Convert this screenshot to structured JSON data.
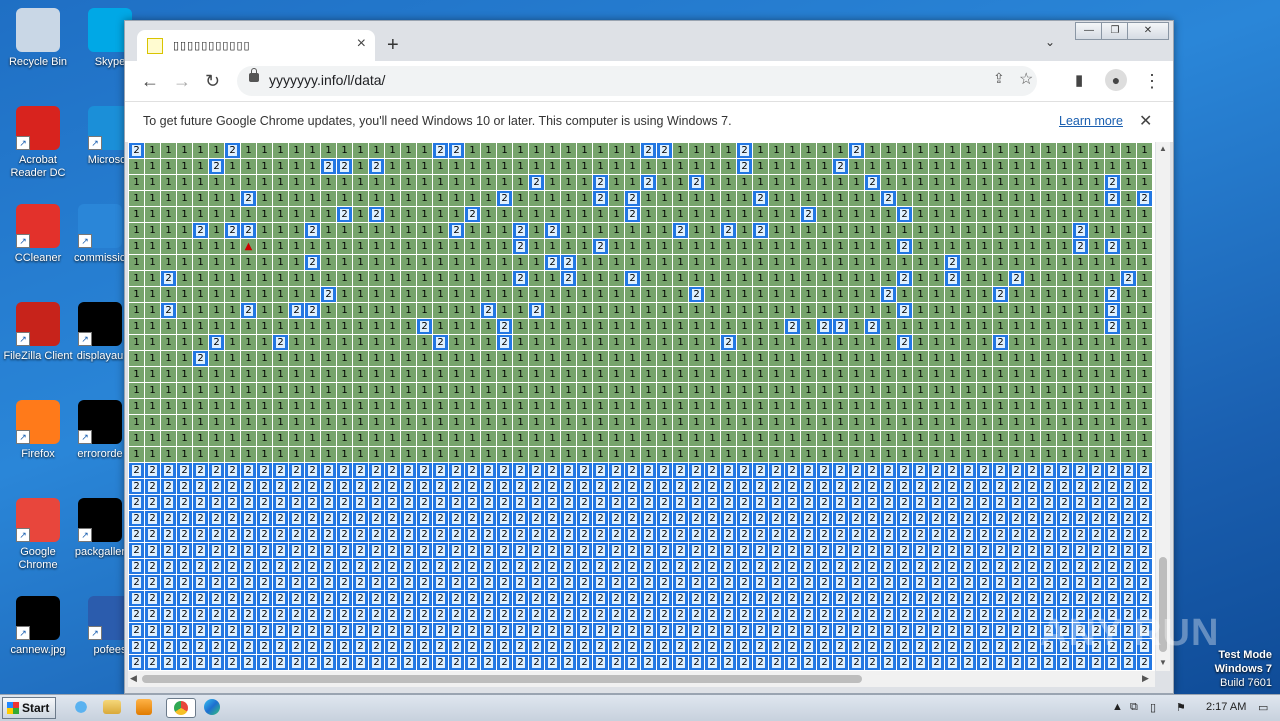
{
  "desktop": {
    "icons": [
      {
        "label": "Recycle Bin",
        "icon": "recycle-bin-icon",
        "color": "#c9d7e6"
      },
      {
        "label": "Skype",
        "icon": "skype-icon",
        "color": "#00a8e6"
      },
      {
        "label": "Acrobat Reader DC",
        "icon": "acrobat-icon",
        "color": "#d8231e"
      },
      {
        "label": "Microsoft",
        "icon": "edge-icon",
        "color": "#1b8fd8"
      },
      {
        "label": "CCleaner",
        "icon": "ccleaner-icon",
        "color": "#e3312b"
      },
      {
        "label": "commissio",
        "icon": "file-icon",
        "color": "#2a86d8"
      },
      {
        "label": "FileZilla Client",
        "icon": "filezilla-icon",
        "color": "#c7231b"
      },
      {
        "label": "displayau",
        "icon": "file-icon",
        "color": "#000000"
      },
      {
        "label": "Firefox",
        "icon": "firefox-icon",
        "color": "#ff7a1a"
      },
      {
        "label": "errororde",
        "icon": "file-icon",
        "color": "#000000"
      },
      {
        "label": "Google Chrome",
        "icon": "chrome-icon",
        "color": "#e8463c"
      },
      {
        "label": "packgaller",
        "icon": "file-icon",
        "color": "#000000"
      },
      {
        "label": "cannew.jpg",
        "icon": "image-file-icon",
        "color": "#000000"
      },
      {
        "label": "pofees",
        "icon": "word-icon",
        "color": "#2b5cad"
      }
    ]
  },
  "browser": {
    "tab_title": "▯▯▯▯▯▯▯▯▯▯▯",
    "url": "yyyyyyy.info/l/data/",
    "infobar_message": "To get future Google Chrome updates, you'll need Windows 10 or later. This computer is using Windows 7.",
    "infobar_link": "Learn more",
    "window_controls": {
      "minimize": "—",
      "restore": "❐",
      "close": "✕"
    }
  },
  "board": {
    "columns": 64,
    "rows": 33,
    "green_color": "#77a46c",
    "blue_color": "#2377e2",
    "rows_data": [
      "2111112111111111111221111111111122111121111112111111111111111111",
      "1111121111112212111111111111111111111121111121111111111111111111",
      "1111111111111111111111111211121121121111111111211111111111111211",
      "1111111211111111111111121111121211111112111111121111111111111212",
      "1111111111111212111112111111111211111111112111112111111111111111",
      "1111212211121111111121112121111111211212111111111111111111121111",
      "11111117111111111111111121111211111111111111111121111111111212",
      "1111111111121111111111111122111111111111111111111112111111111111",
      "1121111111111111111111112112111211111111111111112112111211111121",
      "1111111111112111111111111111111111121111111111121111112111111211",
      "1121111211221111111111211211111111111111111111112111111111111211",
      "1111111111111111112111121111111111111111121221211111111111111211",
      "1111121112111111111211121111111111111211111111112111112111111111",
      "1111211111111111111111111111111111111111111111111111111111111111",
      "1111111111111111111111111111111111111111111111111111111111111111",
      "1111111111111111111111111111111111111111111111111111111111111111",
      "1111111111111111111111111111111111111111111111111111111111111111",
      "1111111111111111111111111111111111111111111111111111111111111111",
      "1111111111111111111111111111111111111111111111111111111111111111",
      "1111111111111111111111111111111111111111111111111111111111111111",
      "2222222222222222222222222222222222222222222222222222222222222222",
      "2222222222222222222222222222222222222222222222222222222222222222",
      "2222222222222222222222222222222222222222222222222222222222222222",
      "2222222222222222222222222222222222222222222222222222222222222222",
      "2222222222222222222222222222222222222222222222222222222222222222",
      "2222222222222222222222222222222222222222222222222222222222222222",
      "2222222222222222222222222222222222222222222222222222222222222222",
      "2222222222222222222222222222222222222222222222222222222222222222",
      "2222222222222222222222222222222222222222222222222222222222222222",
      "2222222222222222222222222222222222222222222222222222222222222222",
      "2222222222222222222222222222222222222222222222222222222222222222",
      "2222222222222222222222222222222222222222222222222222222222222222",
      "2222222222222222222222222222222222222222222222222222222222222222"
    ],
    "warning_symbol": "▲"
  },
  "taskbar": {
    "start_label": "Start",
    "clock": "2:17 AM",
    "watermark_line1": "Test Mode",
    "watermark_line2": "Windows 7",
    "watermark_line3": "Build 7601",
    "overlay_text": "ANY RUN"
  }
}
